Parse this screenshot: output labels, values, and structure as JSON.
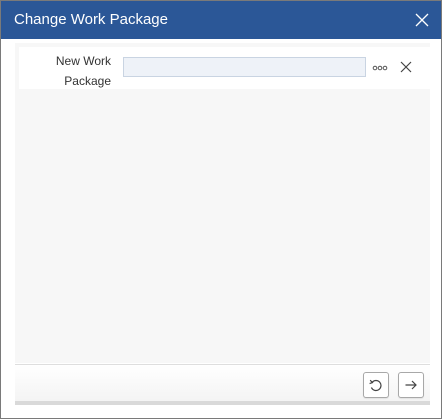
{
  "dialog": {
    "title": "Change Work Package"
  },
  "form": {
    "new_work_package_label": "New Work Package",
    "new_work_package_value": ""
  },
  "icons": {
    "close": "close-icon",
    "more": "ellipsis-icon",
    "clear": "clear-icon",
    "reset": "undo-icon",
    "next": "arrow-right-icon"
  },
  "colors": {
    "titlebar": "#2b5797",
    "input_bg": "#eef2f8"
  }
}
